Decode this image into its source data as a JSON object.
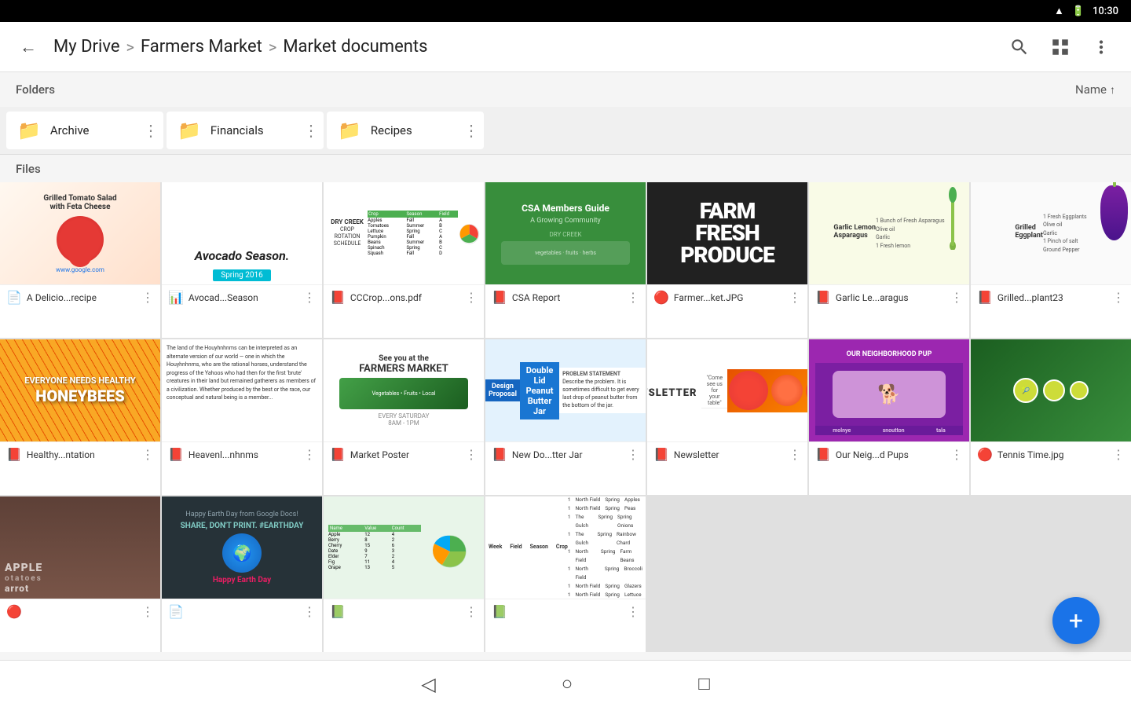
{
  "statusBar": {
    "time": "10:30"
  },
  "topBar": {
    "backLabel": "←",
    "breadcrumb": {
      "root": "My Drive",
      "sep1": ">",
      "mid": "Farmers Market",
      "sep2": ">",
      "current": "Market documents"
    },
    "sortLabel": "Name",
    "sortIcon": "↑"
  },
  "sections": {
    "folders": "Folders",
    "files": "Files"
  },
  "folders": [
    {
      "name": "Archive",
      "color": "gray"
    },
    {
      "name": "Financials",
      "color": "yellow"
    },
    {
      "name": "Recipes",
      "color": "purple"
    }
  ],
  "files": [
    {
      "name": "A Delicio...recipe",
      "type": "doc",
      "thumbType": "tomato"
    },
    {
      "name": "Avocad...Season",
      "type": "slide",
      "thumbType": "avocado"
    },
    {
      "name": "CCCrop...ons.pdf",
      "type": "pdf",
      "thumbType": "cccrop"
    },
    {
      "name": "CSA Report",
      "type": "pdf",
      "thumbType": "csa"
    },
    {
      "name": "Farmer...ket.JPG",
      "type": "image",
      "thumbType": "produce"
    },
    {
      "name": "Garlic Le...aragus",
      "type": "pdf",
      "thumbType": "garlic"
    },
    {
      "name": "Grilled...plant23",
      "type": "pdf",
      "thumbType": "eggplant"
    },
    {
      "name": "Healthy...ntation",
      "type": "pdf",
      "thumbType": "honeybee"
    },
    {
      "name": "Heavenl...nhnms",
      "type": "pdf",
      "thumbType": "text"
    },
    {
      "name": "Market Poster",
      "type": "pdf",
      "thumbType": "marketposter"
    },
    {
      "name": "New Do...tter Jar",
      "type": "pdf",
      "thumbType": "peanut"
    },
    {
      "name": "Newsletter",
      "type": "pdf",
      "thumbType": "orange"
    },
    {
      "name": "Our Neig...d Pups",
      "type": "pdf",
      "thumbType": "pup"
    },
    {
      "name": "Tennis Time.jpg",
      "type": "image",
      "thumbType": "tennis"
    },
    {
      "name": "",
      "type": "image",
      "thumbType": "produce2"
    },
    {
      "name": "",
      "type": "doc",
      "thumbType": "earth"
    },
    {
      "name": "",
      "type": "sheet",
      "thumbType": "spreadsheet"
    },
    {
      "name": "",
      "type": "sheet",
      "thumbType": "spreadsheet2"
    }
  ],
  "fab": {
    "label": "+"
  },
  "nav": {
    "back": "◁",
    "home": "○",
    "recent": "□"
  }
}
